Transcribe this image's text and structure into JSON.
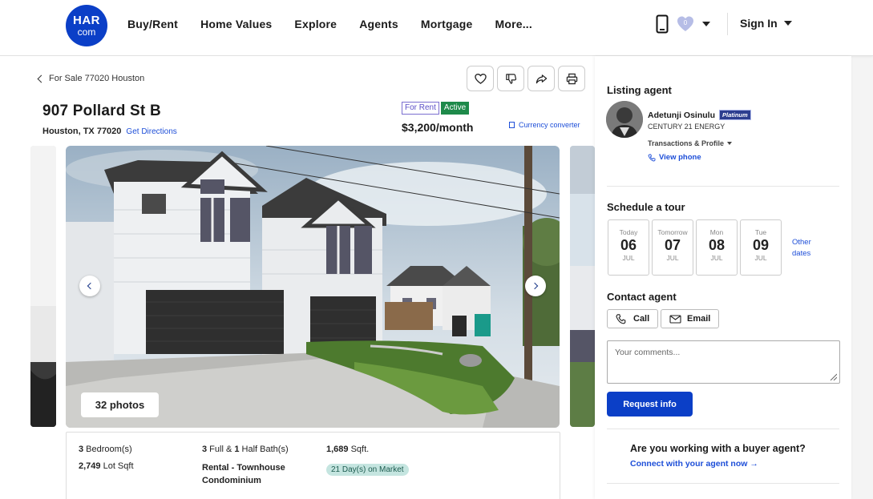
{
  "header": {
    "logo_top": "HAR",
    "logo_bottom": "com",
    "nav": [
      "Buy/Rent",
      "Home Values",
      "Explore",
      "Agents",
      "Mortgage",
      "More..."
    ],
    "favorites_count": "0",
    "sign_in": "Sign In",
    "brand_color": "#0b3fc7"
  },
  "listing": {
    "back_label": "For Sale 77020 Houston",
    "address": "907 Pollard St B",
    "city_line": "Houston, TX 77020",
    "directions": "Get Directions",
    "badge_rent": "For Rent",
    "badge_active": "Active",
    "price": "$3,200/month",
    "currency_converter": "Currency converter",
    "photos_label": "32 photos",
    "facts": {
      "bed_num": "3",
      "bed_label": " Bedroom(s)",
      "bath_full": "3",
      "bath_mid": " Full & ",
      "bath_half": "1",
      "bath_label": " Half Bath(s)",
      "sqft": "1,689",
      "sqft_label": " Sqft.",
      "lot_num": "2,749",
      "lot_label": " Lot Sqft",
      "type_line1": "Rental - Townhouse",
      "type_line2": "Condominium",
      "dom": "21 Day(s) on Market"
    }
  },
  "panel": {
    "listing_agent_title": "Listing agent",
    "agent_name": "Adetunji Osinulu",
    "agent_tier": "Platinum",
    "agent_company": "CENTURY 21 ENERGY",
    "transactions": "Transactions & Profile",
    "view_phone": "View phone",
    "tour_title": "Schedule a tour",
    "days": [
      {
        "name": "Today",
        "date": "06",
        "month": "JUL"
      },
      {
        "name": "Tomorrow",
        "date": "07",
        "month": "JUL"
      },
      {
        "name": "Mon",
        "date": "08",
        "month": "JUL"
      },
      {
        "name": "Tue",
        "date": "09",
        "month": "JUL"
      }
    ],
    "other_dates": "Other dates",
    "contact_title": "Contact agent",
    "call": "Call",
    "email": "Email",
    "comments_placeholder": "Your comments...",
    "request_info": "Request info",
    "buyer_question": "Are you working with a buyer agent?",
    "buyer_link": "Connect with your agent now →"
  }
}
